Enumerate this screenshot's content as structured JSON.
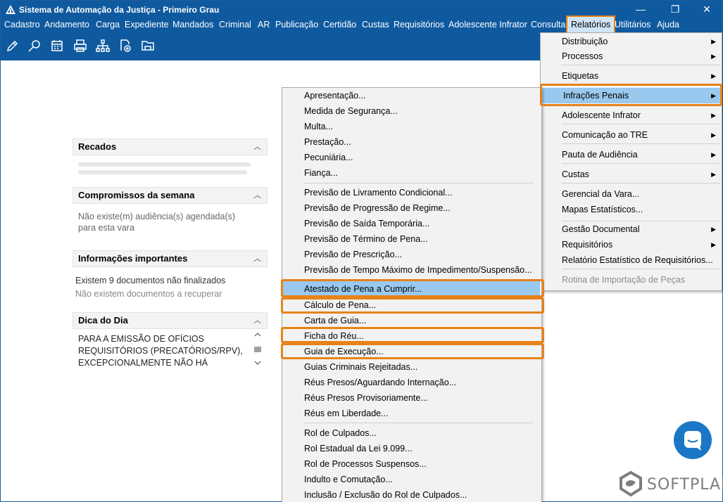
{
  "window": {
    "title": "Sistema de Automação da Justiça - Primeiro Grau",
    "minimize": "—",
    "restore": "❐",
    "close": "✕"
  },
  "menubar": [
    "Cadastro",
    "Andamento",
    "Carga",
    "Expediente",
    "Mandados",
    "Criminal",
    "AR",
    "Publicação",
    "Certidão",
    "Custas",
    "Requisitórios",
    "Adolescente Infrator",
    "Consulta",
    "Relatórios",
    "Utilitários",
    "Ajuda"
  ],
  "toolbar_icons": [
    "edit-icon",
    "search-document-icon",
    "calendar-icon",
    "printer-icon",
    "org-chart-icon",
    "add-document-icon",
    "folder-icon"
  ],
  "panels": {
    "recados": {
      "title": "Recados",
      "chevron": "︿"
    },
    "compromissos": {
      "title": "Compromissos da semana",
      "text1": "Não existe(m) audiência(s) agendada(s)",
      "text2": "para esta vara",
      "chevron": "︿"
    },
    "informacoes": {
      "title": "Informações importantes",
      "text1": "Existem 9 documentos não finalizados",
      "text2": "Não existem documentos a recuperar",
      "chevron": "︿"
    },
    "dica": {
      "title": "Dica do Dia",
      "line1": "PARA A EMISSÃO DE OFÍCIOS",
      "line2": "REQUISITÓRIOS (PRECATÓRIOS/RPV),",
      "line3": "EXCEPCIONALMENTE NÃO HÁ",
      "chevron": "︿"
    }
  },
  "relatorios_menu": [
    {
      "label": "Distribuição",
      "submenu": true
    },
    {
      "label": "Processos",
      "submenu": true
    },
    {
      "label": "Etiquetas",
      "submenu": true
    },
    {
      "label": "Infrações Penais",
      "submenu": true,
      "highlighted": true
    },
    {
      "label": "Adolescente Infrator",
      "submenu": true
    },
    {
      "label": "Comunicação ao TRE",
      "submenu": true
    },
    {
      "label": "Pauta de Audiência",
      "submenu": true
    },
    {
      "label": "Custas",
      "submenu": true
    },
    {
      "label": "Gerencial da Vara..."
    },
    {
      "label": "Mapas Estatísticos..."
    },
    {
      "label": "Gestão Documental",
      "submenu": true
    },
    {
      "label": "Requisitórios",
      "submenu": true
    },
    {
      "label": "Relatório Estatístico de Requisitórios..."
    },
    {
      "label": "Rotina de Importação de Peças",
      "disabled": true
    }
  ],
  "infracoes_menu": [
    {
      "label": "Apresentação..."
    },
    {
      "label": "Medida de Segurança..."
    },
    {
      "label": "Multa..."
    },
    {
      "label": "Prestação..."
    },
    {
      "label": "Pecuniária..."
    },
    {
      "label": "Fiança..."
    },
    {
      "label": "Previsão de Livramento Condicional..."
    },
    {
      "label": "Previsão de Progressão de Regime..."
    },
    {
      "label": "Previsão de Saída Temporária..."
    },
    {
      "label": "Previsão de Término de Pena..."
    },
    {
      "label": "Previsão de Prescrição..."
    },
    {
      "label": "Previsão de Tempo Máximo de Impedimento/Suspensão..."
    },
    {
      "label": "Atestado de Pena a Cumprir...",
      "highlighted": true
    },
    {
      "label": "Cálculo de Pena..."
    },
    {
      "label": "Carta de Guia..."
    },
    {
      "label": "Ficha do Réu..."
    },
    {
      "label": "Guia de Execução..."
    },
    {
      "label": "Guias Criminais Rejeitadas..."
    },
    {
      "label": "Réus Presos/Aguardando Internação..."
    },
    {
      "label": "Réus Presos Provisoriamente..."
    },
    {
      "label": "Réus em Liberdade..."
    },
    {
      "label": "Rol de Culpados..."
    },
    {
      "label": "Rol Estadual da Lei 9.099..."
    },
    {
      "label": "Rol de Processos Suspensos..."
    },
    {
      "label": "Indulto e Comutação..."
    },
    {
      "label": "Inclusão / Exclusão do Rol de Culpados..."
    }
  ],
  "branding": {
    "logo_text": "SOFTPLAN"
  },
  "colors": {
    "titlebar": "#0f5a9f",
    "highlight": "#99c9ef",
    "annotation": "#e8821a",
    "chat": "#1b77c5"
  }
}
